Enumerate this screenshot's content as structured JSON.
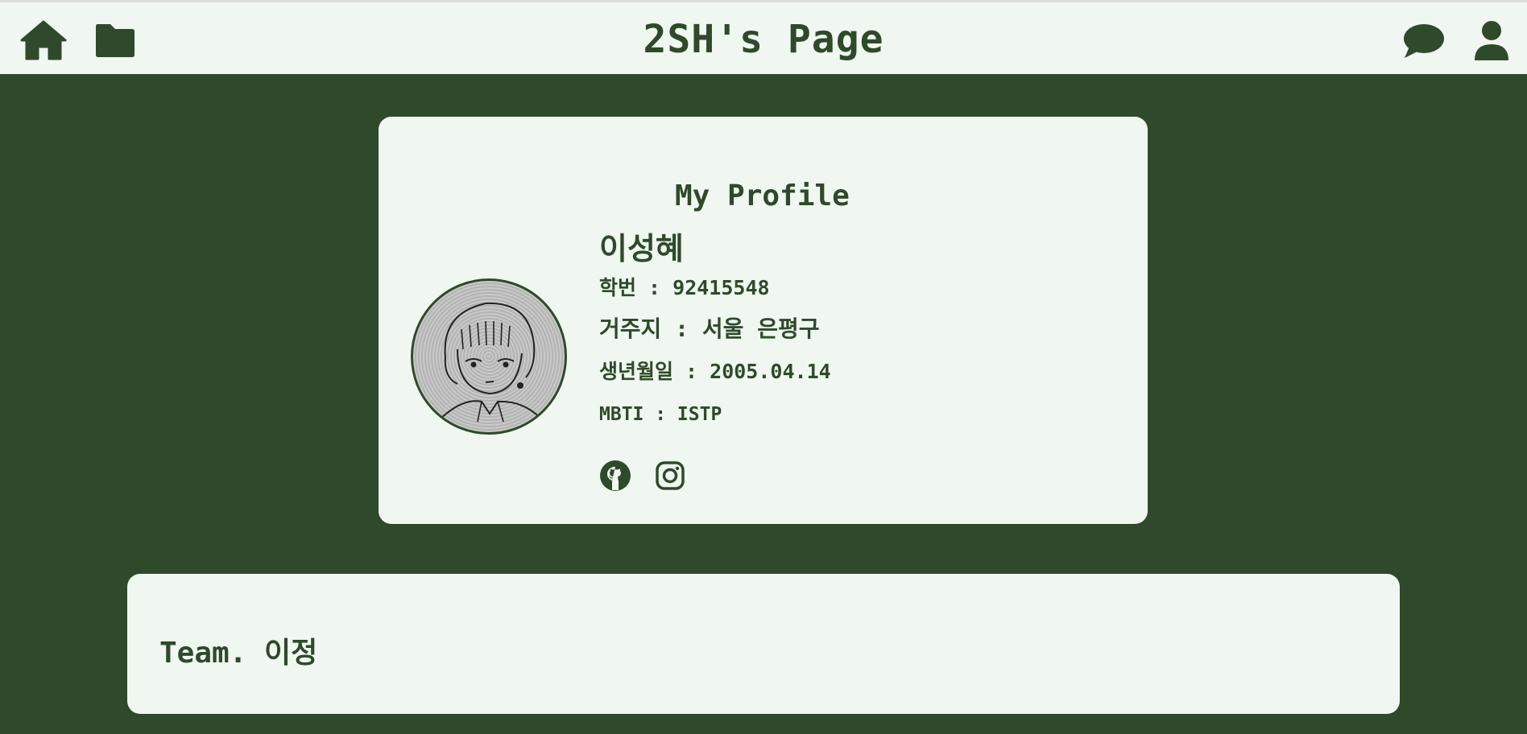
{
  "header": {
    "title": "2SH's Page",
    "icons": [
      "home-icon",
      "folder-icon",
      "chat-icon",
      "user-icon"
    ]
  },
  "profile": {
    "heading": "My Profile",
    "name": "이성혜",
    "student_id": "학번 : 92415548",
    "address": "거주지 : 서울 은평구",
    "birthday": "생년월일 : 2005.04.14",
    "mbti": "MBTI : ISTP",
    "social_icons": [
      "github-icon",
      "instagram-icon"
    ]
  },
  "team": {
    "title": "Team. 이정"
  },
  "colors": {
    "accent": "#2f4a2b",
    "surface": "#eff7f0",
    "background": "#2f4a2b"
  }
}
